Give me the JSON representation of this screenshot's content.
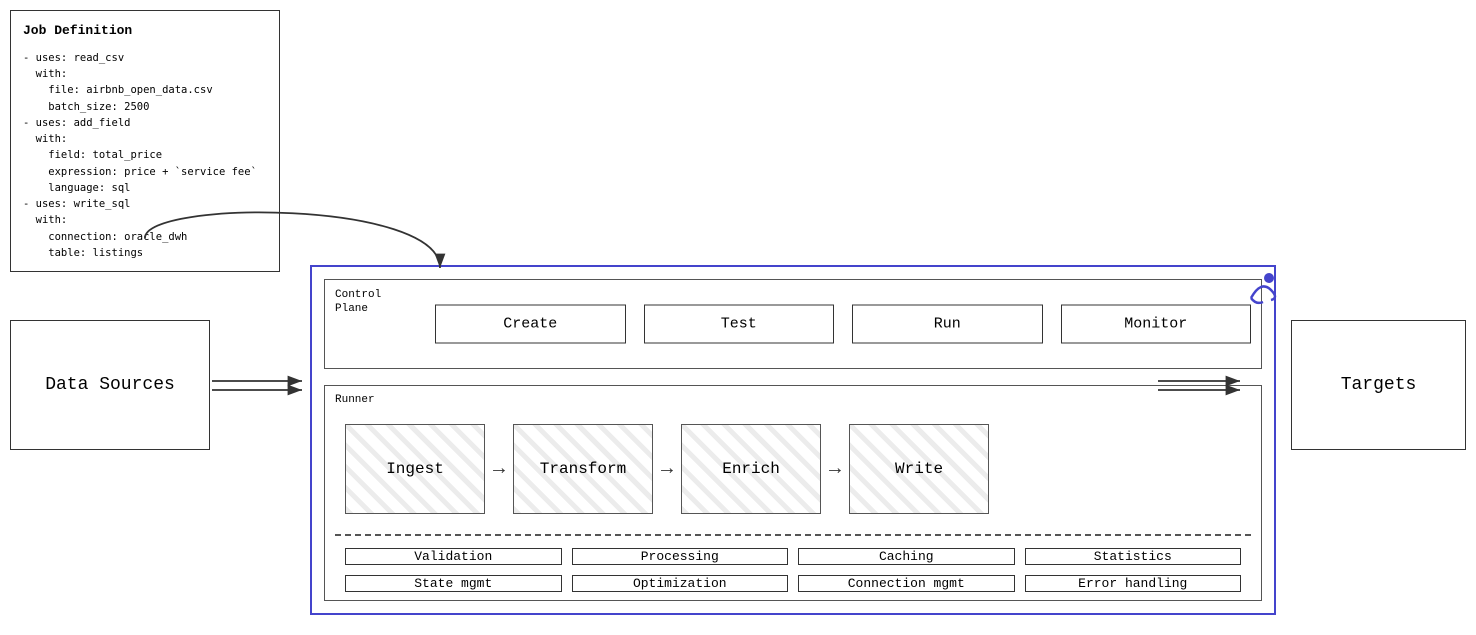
{
  "jobDefinition": {
    "title": "Job Definition",
    "content": "- uses: read_csv\n  with:\n    file: airbnb_open_data.csv\n    batch_size: 2500\n- uses: add_field\n  with:\n    field: total_price\n    expression: price + `service fee`\n    language: sql\n- uses: write_sql\n  with:\n    connection: oracle_dwh\n    table: listings"
  },
  "dataSources": {
    "label": "Data Sources"
  },
  "targets": {
    "label": "Targets"
  },
  "controlPlane": {
    "label": "Control\nPlane",
    "buttons": [
      "Create",
      "Test",
      "Run",
      "Monitor"
    ]
  },
  "runner": {
    "label": "Runner",
    "pipeline": [
      "Ingest",
      "Transform",
      "Enrich",
      "Write"
    ],
    "services": [
      [
        "Validation",
        "Processing",
        "Caching",
        "Statistics"
      ],
      [
        "State mgmt",
        "Optimization",
        "Connection mgmt",
        "Error handling"
      ]
    ]
  }
}
